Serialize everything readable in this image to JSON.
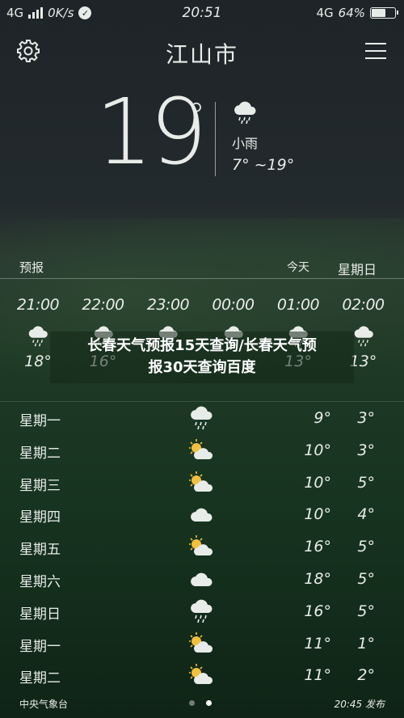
{
  "status": {
    "network": "4G",
    "speed": "0K/s",
    "time": "20:51",
    "network_right": "4G",
    "battery": "64%",
    "battery_level": 0.64
  },
  "header": {
    "city": "江山市"
  },
  "current": {
    "temp": "19",
    "deg": "°",
    "icon": "rain-cloud-icon",
    "desc": "小雨",
    "range": "7°  ~19°"
  },
  "forecast_bar": {
    "label": "预报",
    "today": "今天",
    "weekday": "星期日"
  },
  "hourly": [
    {
      "time": "21:00",
      "temp": "18°",
      "icon": "rain-cloud-icon"
    },
    {
      "time": "22:00",
      "temp": "16°",
      "icon": "rain-cloud-icon"
    },
    {
      "time": "23:00",
      "temp": "",
      "icon": "rain-cloud-icon"
    },
    {
      "time": "00:00",
      "temp": "",
      "icon": "rain-cloud-icon"
    },
    {
      "time": "01:00",
      "temp": "13°",
      "icon": "rain-cloud-icon"
    },
    {
      "time": "02:00",
      "temp": "13°",
      "icon": "rain-cloud-icon"
    }
  ],
  "overlay_text": {
    "line1": "长春天气预报15天查询/长春天气预",
    "line2": "报30天查询百度"
  },
  "daily": [
    {
      "day": "星期一",
      "icon": "rain-cloud-icon",
      "high": "9°",
      "low": "3°"
    },
    {
      "day": "星期二",
      "icon": "partly-cloudy-icon",
      "high": "10°",
      "low": "3°"
    },
    {
      "day": "星期三",
      "icon": "partly-cloudy-icon",
      "high": "10°",
      "low": "5°"
    },
    {
      "day": "星期四",
      "icon": "cloud-icon",
      "high": "10°",
      "low": "4°"
    },
    {
      "day": "星期五",
      "icon": "partly-cloudy-icon",
      "high": "16°",
      "low": "5°"
    },
    {
      "day": "星期六",
      "icon": "cloud-icon",
      "high": "18°",
      "low": "5°"
    },
    {
      "day": "星期日",
      "icon": "rain-cloud-icon",
      "high": "16°",
      "low": "5°"
    },
    {
      "day": "星期一",
      "icon": "partly-cloudy-icon",
      "high": "11°",
      "low": "1°"
    },
    {
      "day": "星期二",
      "icon": "partly-cloudy-icon",
      "high": "11°",
      "low": "2°"
    }
  ],
  "footer": {
    "source": "中央气象台",
    "published": "20:45 发布"
  },
  "colors": {
    "text": "#e8ece8",
    "sun": "#f0c040"
  }
}
